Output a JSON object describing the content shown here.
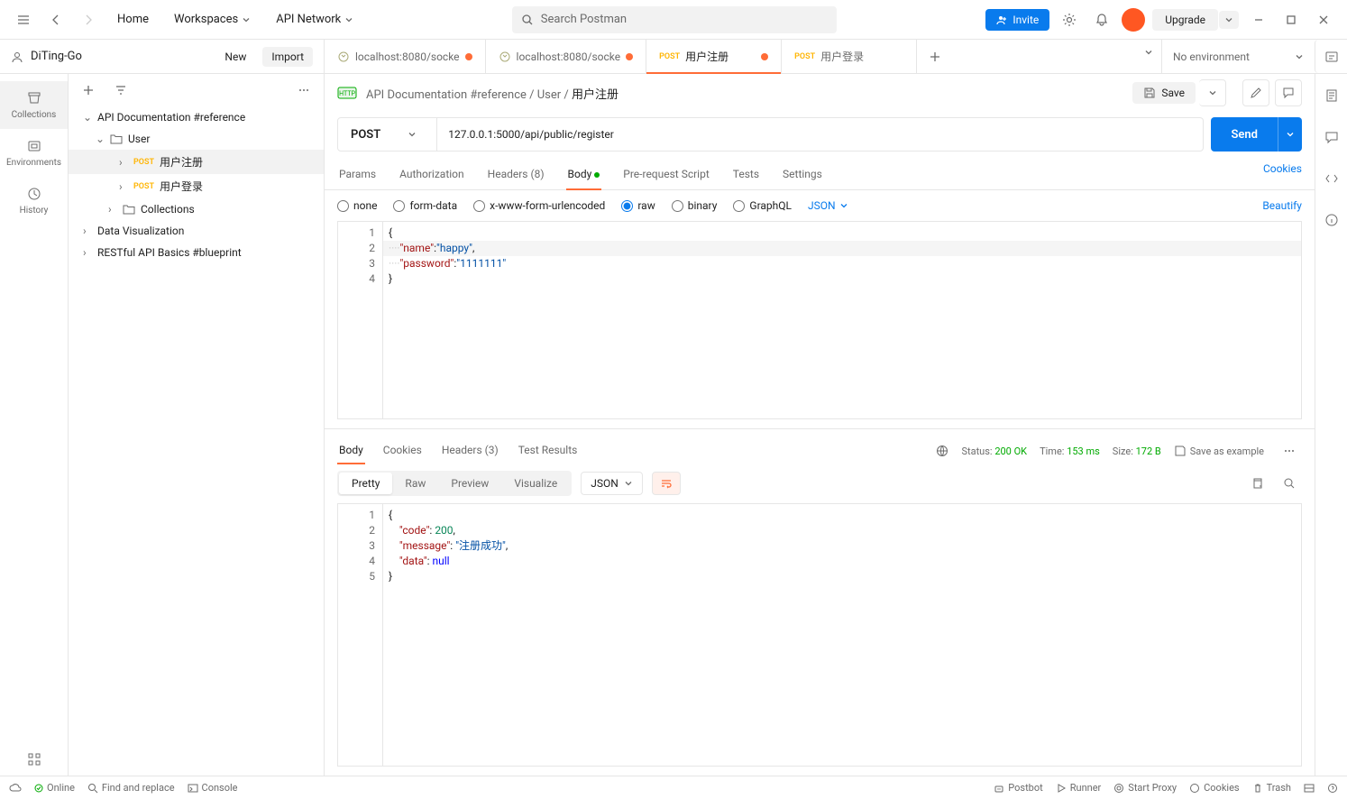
{
  "topbar": {
    "home": "Home",
    "workspaces": "Workspaces",
    "api_network": "API Network",
    "search_placeholder": "Search Postman",
    "invite": "Invite",
    "upgrade": "Upgrade"
  },
  "workspace": {
    "name": "DiTing-Go",
    "new_btn": "New",
    "import_btn": "Import"
  },
  "rail": {
    "collections": "Collections",
    "environments": "Environments",
    "history": "History"
  },
  "tree": {
    "root": "API Documentation #reference",
    "user": "User",
    "req1_method": "POST",
    "req1": "用户注册",
    "req2_method": "POST",
    "req2": "用户登录",
    "coll": "Collections",
    "dv": "Data Visualization",
    "rest": "RESTful API Basics #blueprint"
  },
  "tabs": {
    "t1": "localhost:8080/socke",
    "t2": "localhost:8080/socke",
    "t3_method": "POST",
    "t3": "用户注册",
    "t4_method": "POST",
    "t4": "用户登录"
  },
  "env": {
    "none": "No environment"
  },
  "crumb": {
    "a": "API Documentation #reference",
    "b": "User",
    "c": "用户注册",
    "save": "Save"
  },
  "request": {
    "method": "POST",
    "url": "127.0.0.1:5000/api/public/register",
    "send": "Send"
  },
  "req_tabs": {
    "params": "Params",
    "auth": "Authorization",
    "headers": "Headers (8)",
    "body": "Body",
    "prereq": "Pre-request Script",
    "tests": "Tests",
    "settings": "Settings",
    "cookies": "Cookies"
  },
  "body_opts": {
    "none": "none",
    "formdata": "form-data",
    "xwww": "x-www-form-urlencoded",
    "raw": "raw",
    "binary": "binary",
    "graphql": "GraphQL",
    "lang": "JSON",
    "beautify": "Beautify"
  },
  "req_body": {
    "l1": "{",
    "l2_key": "\"name\"",
    "l2_val": "\"happy\"",
    "l3_key": "\"password\"",
    "l3_val": "\"1111111\"",
    "l4": "}"
  },
  "resp_tabs": {
    "body": "Body",
    "cookies": "Cookies",
    "headers": "Headers (3)",
    "tests": "Test Results"
  },
  "resp_status": {
    "status_label": "Status:",
    "status": "200 OK",
    "time_label": "Time:",
    "time": "153 ms",
    "size_label": "Size:",
    "size": "172 B",
    "save_ex": "Save as example"
  },
  "resp_opts": {
    "pretty": "Pretty",
    "raw": "Raw",
    "preview": "Preview",
    "visualize": "Visualize",
    "lang": "JSON"
  },
  "resp_body": {
    "l1": "{",
    "l2_k": "\"code\"",
    "l2_v": "200",
    "l3_k": "\"message\"",
    "l3_v": "\"注册成功\"",
    "l4_k": "\"data\"",
    "l4_v": "null",
    "l5": "}"
  },
  "footer": {
    "online": "Online",
    "find": "Find and replace",
    "console": "Console",
    "postbot": "Postbot",
    "runner": "Runner",
    "proxy": "Start Proxy",
    "cookies": "Cookies",
    "trash": "Trash"
  }
}
